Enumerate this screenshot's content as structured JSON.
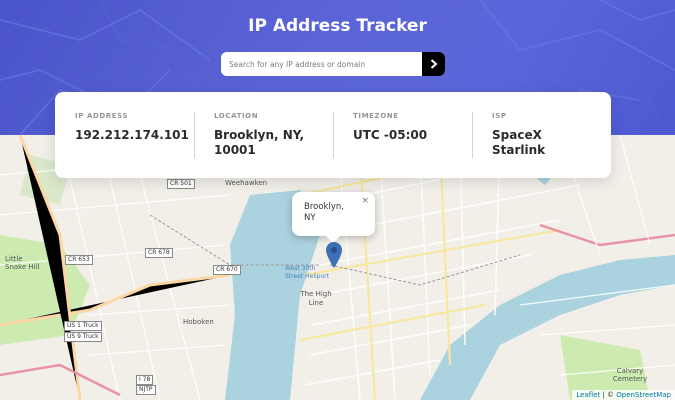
{
  "app": {
    "title": "IP Address Tracker"
  },
  "search": {
    "placeholder": "Search for any IP address or domain",
    "value": "",
    "button_icon": "chevron-right-icon"
  },
  "info": [
    {
      "label": "IP ADDRESS",
      "value": "192.212.174.101"
    },
    {
      "label": "LOCATION",
      "value": "Brooklyn, NY, 10001"
    },
    {
      "label": "TIMEZONE",
      "value": "UTC -05:00"
    },
    {
      "label": "ISP",
      "value": "SpaceX Starlink"
    }
  ],
  "map": {
    "popup_text": "Brooklyn, NY",
    "popup_close": "×",
    "place_labels": {
      "weehawken": "Weehawken",
      "hoboken": "Hoboken",
      "little_snake_hill": "Little Snake Hill",
      "high_line": "The High Line",
      "heliport": "West 30th Street Heliport",
      "calvary": "Calvary Cemetery"
    },
    "road_shields": {
      "cr501": "CR 501",
      "cr653": "CR 653",
      "cr678": "CR 678",
      "cr670": "CR 670",
      "us1": "US 1 Truck",
      "us9": "US 9 Truck",
      "njtp": "NJTP",
      "i78": "I 78"
    },
    "attribution_leaflet": "Leaflet",
    "attribution_sep": " | © ",
    "attribution_osm": "OpenStreetMap"
  },
  "colors": {
    "header_gradient_start": "#4a55c9",
    "header_gradient_end": "#5b66da",
    "marker": "#3b6fb6",
    "water": "#aad3df"
  }
}
